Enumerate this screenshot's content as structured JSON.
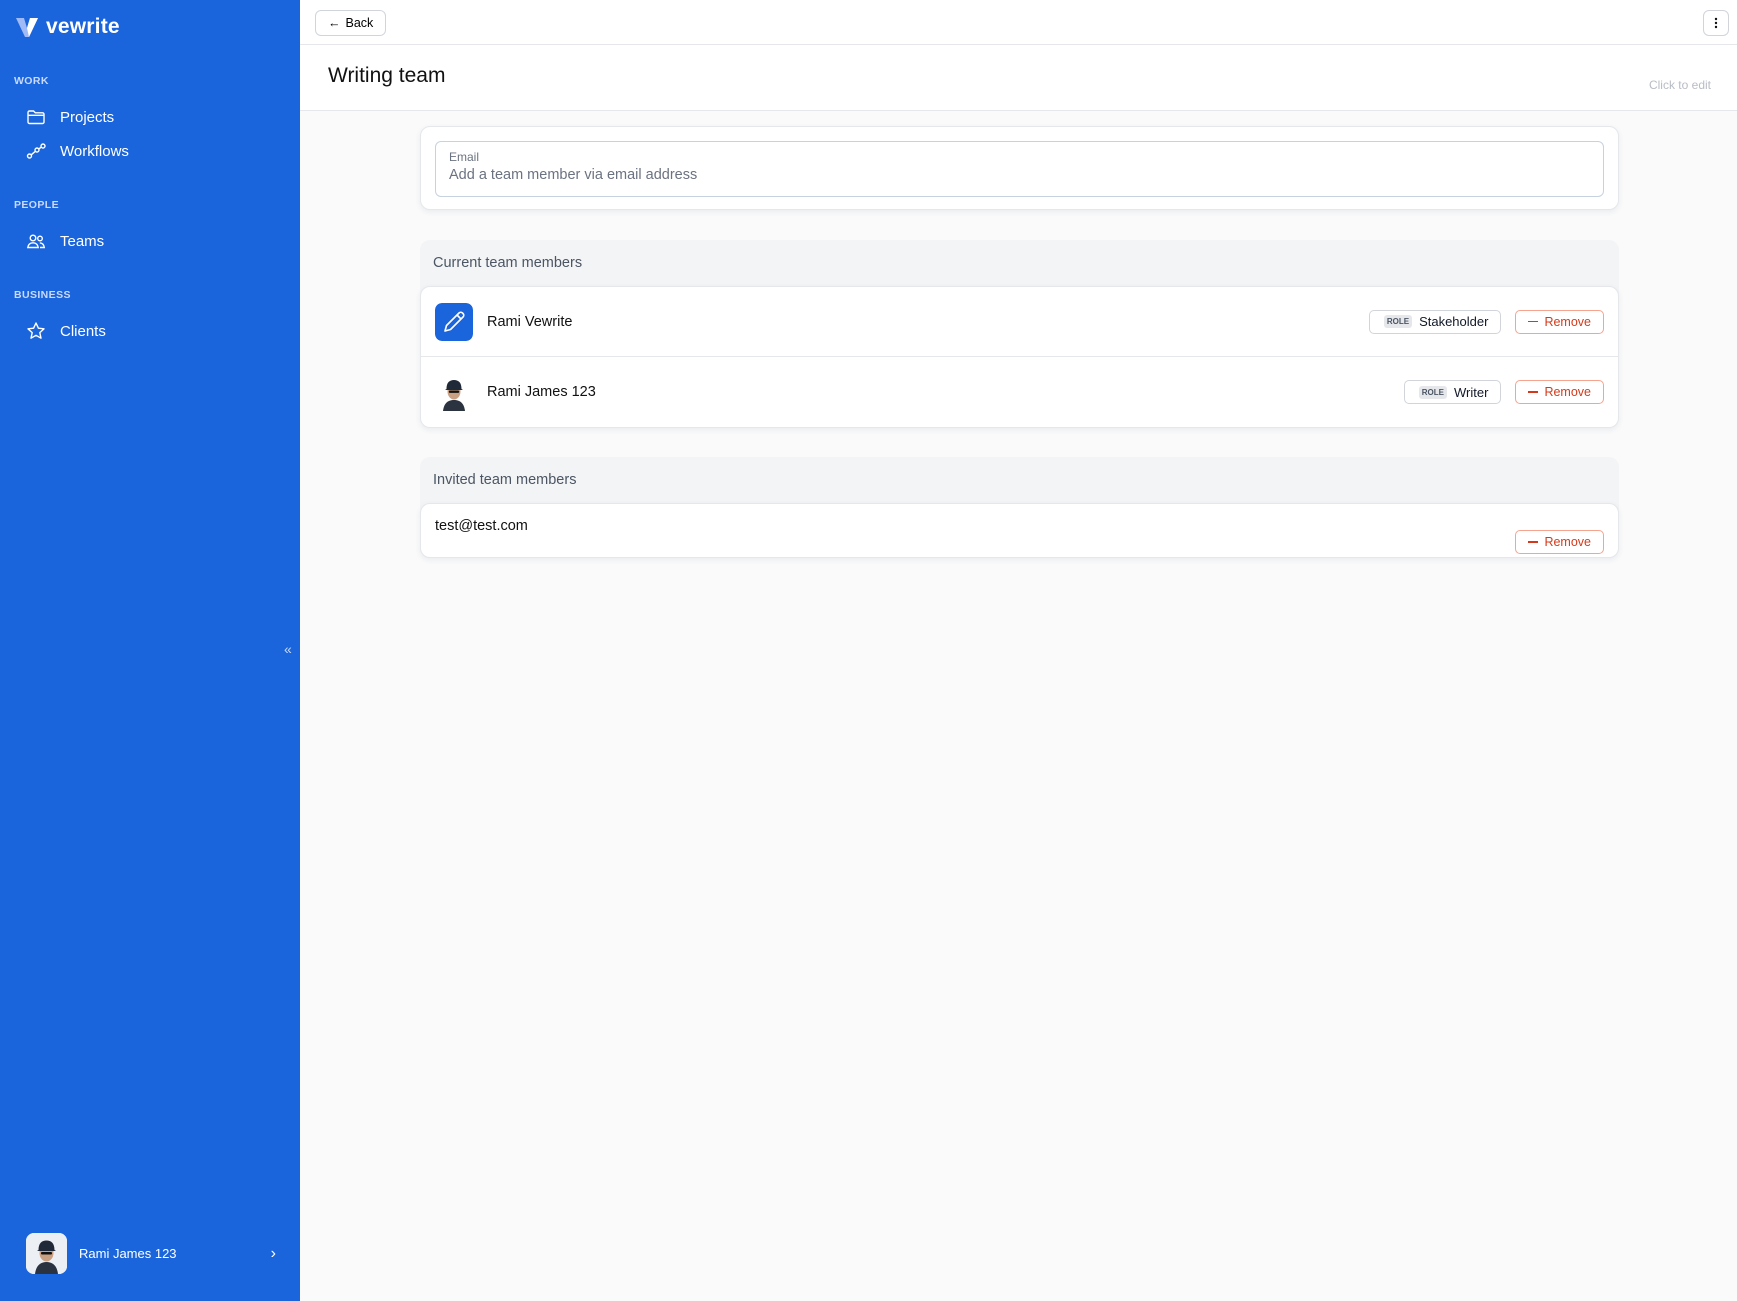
{
  "brand": {
    "name": "vewrite",
    "accent": "#1a64dc"
  },
  "sidebar": {
    "sections": [
      {
        "label": "WORK",
        "items": [
          {
            "label": "Projects",
            "icon": "folder-icon"
          },
          {
            "label": "Workflows",
            "icon": "workflow-icon"
          }
        ]
      },
      {
        "label": "PEOPLE",
        "items": [
          {
            "label": "Teams",
            "icon": "users-icon"
          }
        ]
      },
      {
        "label": "BUSINESS",
        "items": [
          {
            "label": "Clients",
            "icon": "star-icon"
          }
        ]
      }
    ],
    "user": {
      "name": "Rami James 123"
    }
  },
  "topbar": {
    "back_label": "Back"
  },
  "header": {
    "title": "Writing team",
    "edit_hint": "Click to edit"
  },
  "email": {
    "label": "Email",
    "placeholder": "Add a team member via email address",
    "value": ""
  },
  "current": {
    "title": "Current team members",
    "members": [
      {
        "name": "Rami Vewrite",
        "role_tag": "ROLE",
        "role": "Stakeholder",
        "remove_label": "Remove"
      },
      {
        "name": "Rami James 123",
        "role_tag": "ROLE",
        "role": "Writer",
        "remove_label": "Remove"
      }
    ]
  },
  "invited": {
    "title": "Invited team members",
    "members": [
      {
        "email": "test@test.com",
        "remove_label": "Remove"
      }
    ]
  }
}
